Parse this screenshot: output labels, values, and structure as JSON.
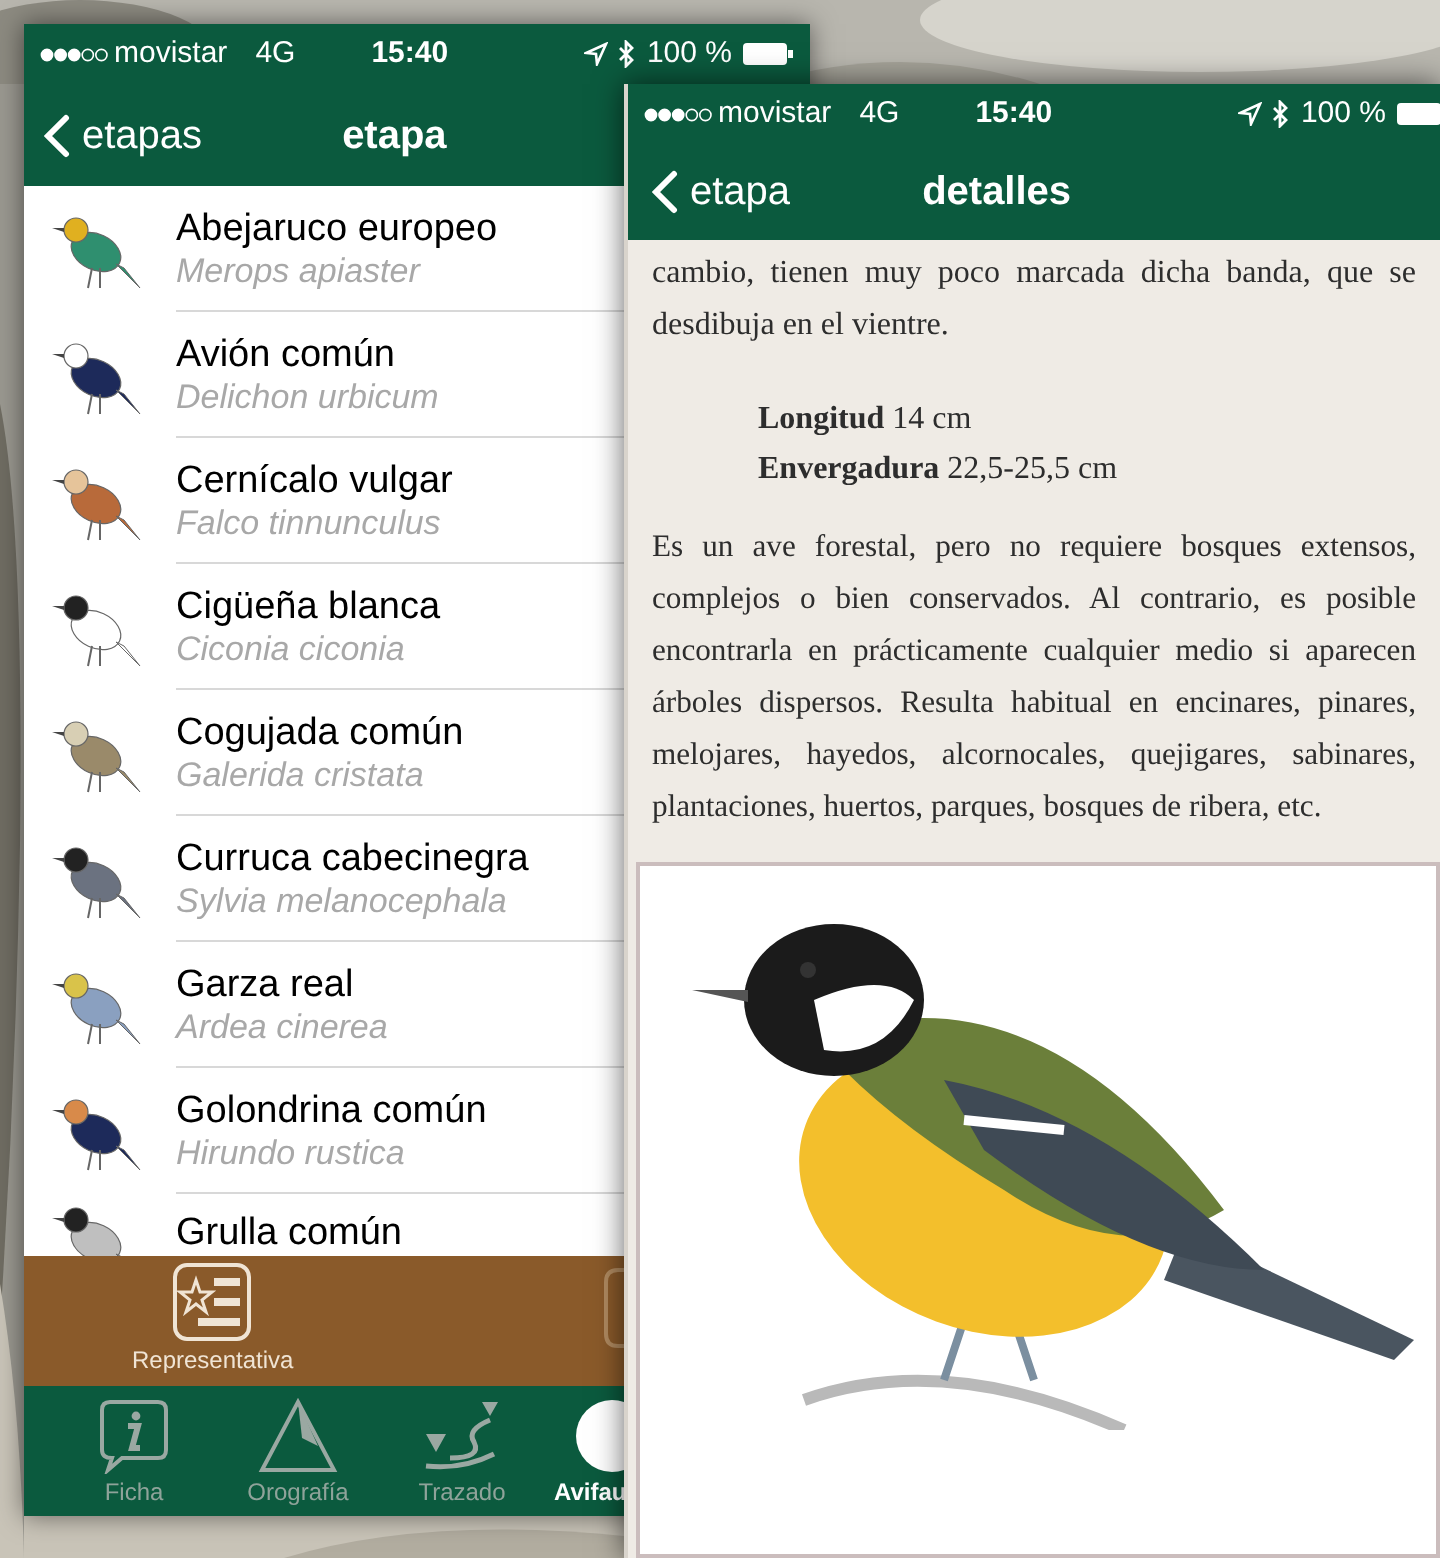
{
  "left_screen": {
    "status_bar": {
      "carrier": "movistar",
      "network": "4G",
      "time": "15:40",
      "battery": "100 %"
    },
    "nav": {
      "back": "etapas",
      "title": "etapa"
    },
    "birds": [
      {
        "name": "Abejaruco europeo",
        "latin": "Merops apiaster"
      },
      {
        "name": "Avión común",
        "latin": "Delichon urbicum"
      },
      {
        "name": "Cernícalo vulgar",
        "latin": "Falco tinnunculus"
      },
      {
        "name": "Cigüeña blanca",
        "latin": "Ciconia ciconia"
      },
      {
        "name": "Cogujada común",
        "latin": "Galerida cristata"
      },
      {
        "name": "Curruca cabecinegra",
        "latin": "Sylvia melanocephala"
      },
      {
        "name": "Garza real",
        "latin": "Ardea cinerea"
      },
      {
        "name": "Golondrina común",
        "latin": "Hirundo rustica"
      },
      {
        "name": "Grulla común"
      }
    ],
    "toolbar": {
      "button": "Representativa"
    },
    "tabs": [
      {
        "kind": "info",
        "label": "Ficha",
        "selected": false
      },
      {
        "kind": "terrain",
        "label": "Orografía",
        "selected": false
      },
      {
        "kind": "route",
        "label": "Trazado",
        "selected": false
      },
      {
        "kind": "birds",
        "label": "Avifau",
        "selected": true
      }
    ]
  },
  "right_screen": {
    "status_bar": {
      "carrier": "movistar",
      "network": "4G",
      "time": "15:40",
      "battery": "100 %"
    },
    "nav": {
      "back": "etapa",
      "title": "detalles"
    },
    "intro": "cambio, tienen muy poco marcada dicha banda, que se desdibuja en el vientre.",
    "measurements": [
      "**Longitud** 14 cm",
      "**Envergadura** 22,5-25,5 cm"
    ],
    "paragraph": "Es un ave forestal, pero no requiere bosques extensos, complejos o bien conservados. Al contrario, es posible encontrarla en prácticamente cualquier medio si aparecen árboles dispersos. Resulta habitual en encinares, pinares, melojares, hayedos, alcornocales, quejigares, sabinares, plantaciones, huertos, parques, bosques de ribera, etc."
  }
}
